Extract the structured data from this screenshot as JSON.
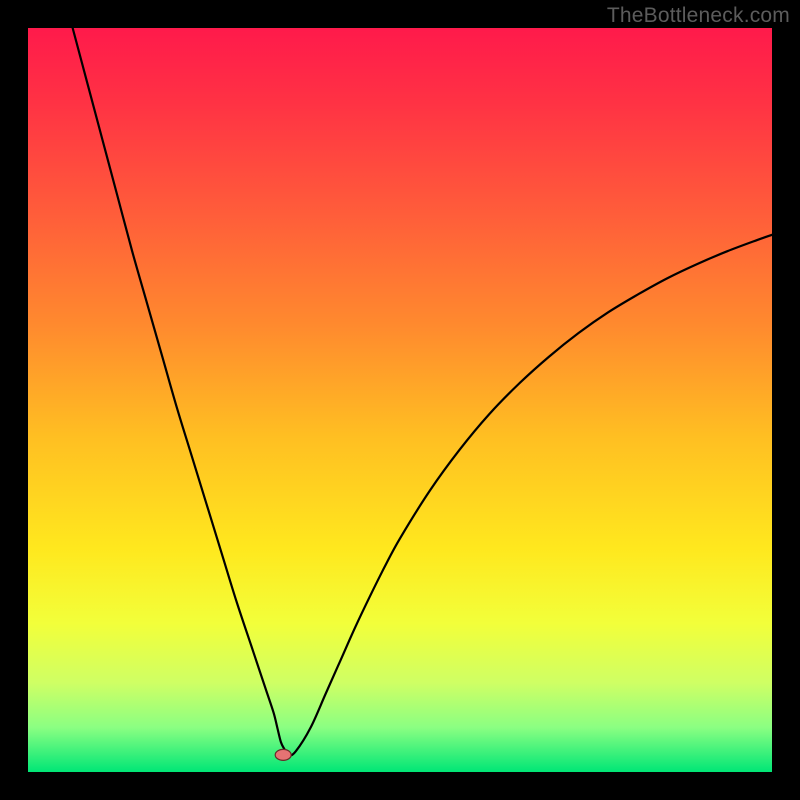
{
  "watermark": "TheBottleneck.com",
  "colors": {
    "frame": "#000000",
    "gradient_stops": [
      {
        "offset": 0.0,
        "color": "#ff1a4b"
      },
      {
        "offset": 0.1,
        "color": "#ff3244"
      },
      {
        "offset": 0.25,
        "color": "#ff5d3a"
      },
      {
        "offset": 0.4,
        "color": "#ff8a2e"
      },
      {
        "offset": 0.55,
        "color": "#ffbf22"
      },
      {
        "offset": 0.7,
        "color": "#ffe81e"
      },
      {
        "offset": 0.8,
        "color": "#f2ff3a"
      },
      {
        "offset": 0.88,
        "color": "#cfff64"
      },
      {
        "offset": 0.94,
        "color": "#8bff82"
      },
      {
        "offset": 1.0,
        "color": "#00e676"
      }
    ],
    "curve": "#000000",
    "dot_fill": "#e57373",
    "dot_stroke": "#6a2a2a"
  },
  "chart_data": {
    "type": "line",
    "title": "",
    "xlabel": "",
    "ylabel": "",
    "xlim": [
      0,
      100
    ],
    "ylim": [
      0,
      100
    ],
    "grid": false,
    "legend": false,
    "series": [
      {
        "name": "bottleneck-curve",
        "x": [
          6,
          8,
          10,
          12,
          14,
          16,
          18,
          20,
          22,
          24,
          26,
          28,
          30,
          31,
          32,
          33,
          33.5,
          34,
          34.5,
          35,
          36,
          38,
          40,
          42,
          44,
          46,
          48,
          50,
          54,
          58,
          62,
          66,
          70,
          74,
          78,
          82,
          86,
          90,
          94,
          98,
          100
        ],
        "y": [
          100,
          92.5,
          85,
          77.5,
          70,
          63,
          56,
          49,
          42.5,
          36,
          29.5,
          23,
          17,
          14,
          11,
          8,
          6,
          4,
          3,
          2.2,
          2.8,
          6,
          10.5,
          15,
          19.5,
          23.7,
          27.7,
          31.4,
          37.8,
          43.3,
          48.1,
          52.2,
          55.8,
          59.0,
          61.8,
          64.2,
          66.4,
          68.3,
          70.0,
          71.5,
          72.2
        ]
      }
    ],
    "annotations": [
      {
        "name": "minimum-marker",
        "x": 34.3,
        "y": 2.3
      }
    ]
  }
}
